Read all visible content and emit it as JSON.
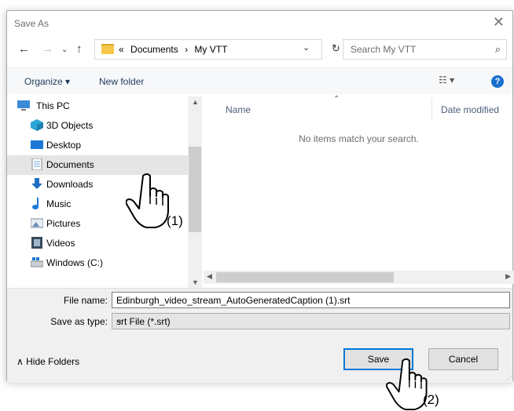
{
  "dialog": {
    "title": "Save As"
  },
  "address": {
    "crumbs": [
      "«",
      "Documents",
      "›",
      "My VTT"
    ]
  },
  "search": {
    "placeholder": "Search My VTT"
  },
  "toolbar": {
    "organize": "Organize ▾",
    "new_folder": "New folder",
    "view": "☷ ▾",
    "help": "?"
  },
  "nav": {
    "items": [
      {
        "label": "This PC",
        "icon": "computer-icon"
      },
      {
        "label": "3D Objects",
        "icon": "cube-icon"
      },
      {
        "label": "Desktop",
        "icon": "desktop-icon"
      },
      {
        "label": "Documents",
        "icon": "document-icon",
        "state": "hovered"
      },
      {
        "label": "Downloads",
        "icon": "download-icon"
      },
      {
        "label": "Music",
        "icon": "music-icon"
      },
      {
        "label": "Pictures",
        "icon": "picture-icon"
      },
      {
        "label": "Videos",
        "icon": "video-icon"
      },
      {
        "label": "Windows (C:)",
        "icon": "drive-icon"
      }
    ]
  },
  "content": {
    "columns": [
      "Name",
      "Date modified"
    ],
    "empty_message": "No items match your search."
  },
  "form": {
    "file_name_label": "File name:",
    "file_name_value": "Edinburgh_video_stream_AutoGeneratedCaption (1).srt",
    "save_type_label": "Save as type:",
    "save_type_value": "srt File (*.srt)"
  },
  "footer": {
    "hide_folders": "∧  Hide Folders",
    "save": "Save",
    "cancel": "Cancel"
  },
  "annotations": {
    "step1": "(1)",
    "step2": "(2)"
  },
  "colors": {
    "selection": "#cce4f7",
    "accent": "#0078d7",
    "folder": "#f5c84a"
  }
}
